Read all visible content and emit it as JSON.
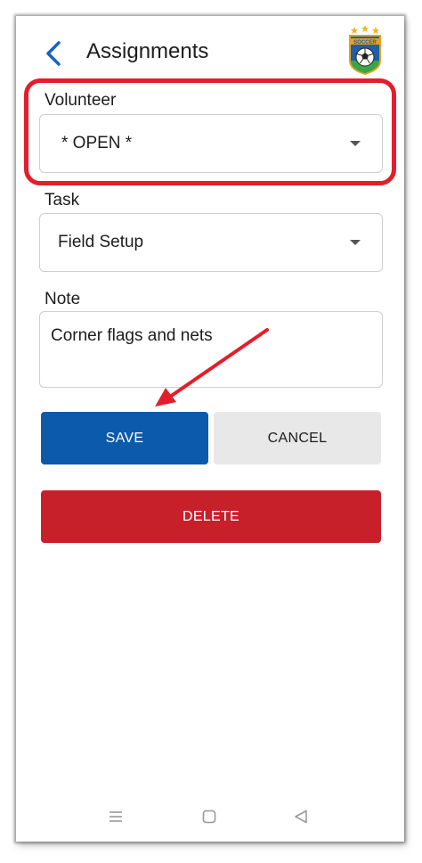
{
  "header": {
    "title": "Assignments",
    "back_icon": "chevron-left-icon",
    "logo_text": "SOCCER"
  },
  "volunteer": {
    "label": "Volunteer",
    "value": "* OPEN *"
  },
  "task": {
    "label": "Task",
    "value": "Field Setup"
  },
  "note": {
    "label": "Note",
    "value": "Corner flags and nets"
  },
  "buttons": {
    "save": "SAVE",
    "cancel": "CANCEL",
    "delete": "DELETE"
  },
  "colors": {
    "accent": "#0b5aab",
    "danger": "#c8202b",
    "annotation": "#e31e2a",
    "neutral_button": "#e8e8e8"
  },
  "nav": {
    "menu_icon": "menu-icon",
    "home_icon": "home-icon",
    "back_icon": "triangle-back-icon"
  }
}
